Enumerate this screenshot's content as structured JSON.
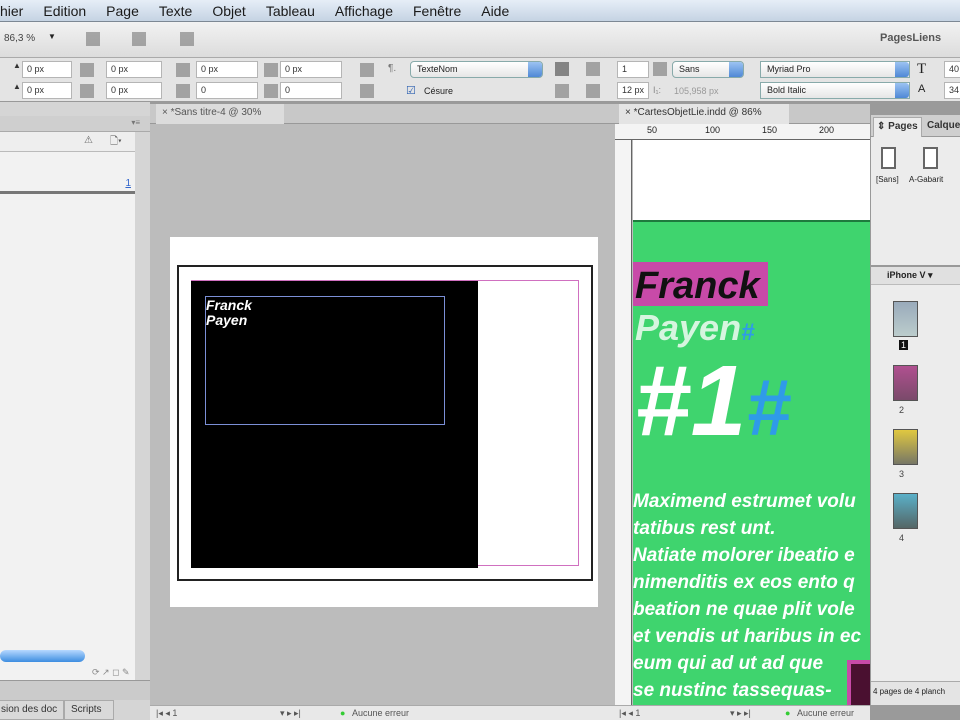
{
  "menu": [
    "hier",
    "Edition",
    "Page",
    "Texte",
    "Objet",
    "Tableau",
    "Affichage",
    "Fenêtre",
    "Aide"
  ],
  "toolbar": {
    "zoom": "86,3 %",
    "workspace": "PagesLiens"
  },
  "control": {
    "f1": "0 px",
    "f2": "0 px",
    "f3": "0 px",
    "f4": "0 px",
    "f5": "0 px",
    "f6": "0 px",
    "f7": "0",
    "f8": "0",
    "para_style": "TexteNom",
    "hyphenation": "Césure",
    "columns": "1",
    "gutter": "12 px",
    "span": "Sans",
    "width_readout": "105,958 px",
    "font": "Myriad Pro",
    "font_style": "Bold Italic",
    "size": "40",
    "leading": "34"
  },
  "left_panel": {
    "page_num": "1",
    "tabs": [
      "sion des doc",
      "Scripts"
    ]
  },
  "doc1": {
    "tab": "*Sans titre-4 @ 30%",
    "text1": "Franck",
    "text2": "Payen",
    "page": "1",
    "status": "Aucune erreur"
  },
  "doc2": {
    "tab": "*CartesObjetLie.indd @ 86%",
    "ruler": [
      "50",
      "100",
      "150",
      "200"
    ],
    "name1": "Franck",
    "name2": "Payen",
    "hash": "#",
    "number": "#1",
    "hash2": "#",
    "body": [
      "Maximend estrumet volu",
      "tatibus rest unt.",
      "Natiate molorer ibeatio e",
      "nimenditis ex eos ento q",
      "beation ne quae plit vole",
      "et vendis ut haribus in ec",
      "eum qui ad ut ad que",
      "se nustinc tassequas-"
    ],
    "page": "1",
    "status": "Aucune erreur",
    "colors": {
      "green": "#3fd46e",
      "magenta": "#c84aa8",
      "blue": "#2f9be8"
    }
  },
  "pages_panel": {
    "tabs": [
      "Pages",
      "Calque"
    ],
    "masters": [
      "[Sans]",
      "A-Gabarit"
    ],
    "preset": "iPhone V",
    "pages": [
      "1",
      "2",
      "3",
      "4"
    ],
    "footer": "4 pages de 4 planch"
  }
}
